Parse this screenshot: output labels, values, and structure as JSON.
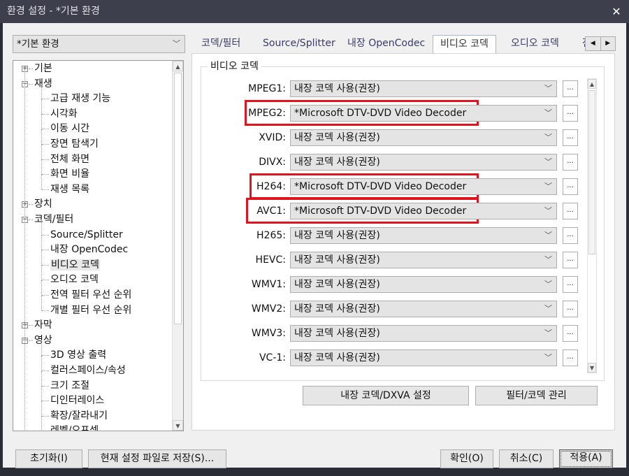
{
  "window": {
    "title": "환경 설정 - *기본 환경",
    "close": "✕"
  },
  "preset": {
    "value": "*기본 환경"
  },
  "tree": [
    {
      "label": "기본",
      "level": 0,
      "expander": "+"
    },
    {
      "label": "재생",
      "level": 0,
      "expander": "−"
    },
    {
      "label": "고급 재생 기능",
      "level": 1
    },
    {
      "label": "시각화",
      "level": 1
    },
    {
      "label": "이동 시간",
      "level": 1
    },
    {
      "label": "장면 탐색기",
      "level": 1
    },
    {
      "label": "전체 화면",
      "level": 1
    },
    {
      "label": "화면 비율",
      "level": 1
    },
    {
      "label": "재생 목록",
      "level": 1
    },
    {
      "label": "장치",
      "level": 0,
      "expander": "+"
    },
    {
      "label": "코덱/필터",
      "level": 0,
      "expander": "−"
    },
    {
      "label": "Source/Splitter",
      "level": 1
    },
    {
      "label": "내장 OpenCodec",
      "level": 1
    },
    {
      "label": "비디오 코덱",
      "level": 1,
      "selected": true
    },
    {
      "label": "오디오 코덱",
      "level": 1
    },
    {
      "label": "전역 필터 우선 순위",
      "level": 1
    },
    {
      "label": "개별 필터 우선 순위",
      "level": 1
    },
    {
      "label": "자막",
      "level": 0,
      "expander": "+"
    },
    {
      "label": "영상",
      "level": 0,
      "expander": "−"
    },
    {
      "label": "3D 영상 출력",
      "level": 1
    },
    {
      "label": "컬러스페이스/속성",
      "level": 1
    },
    {
      "label": "크기 조절",
      "level": 1
    },
    {
      "label": "디인터레이스",
      "level": 1
    },
    {
      "label": "확장/잘라내기",
      "level": 1
    },
    {
      "label": "레벨/오프셋",
      "level": 1
    }
  ],
  "tabs": [
    "코덱/필터",
    "Source/Splitter",
    "내장 OpenCodec",
    "비디오 코덱",
    "오디오 코덱",
    "전"
  ],
  "active_tab": "비디오 코덱",
  "group": {
    "title": "비디오 코덱"
  },
  "codecs": [
    {
      "label": "MPEG1:",
      "value": "내장 코덱 사용(권장)",
      "highlighted": false
    },
    {
      "label": "MPEG2:",
      "value": "*Microsoft DTV-DVD Video Decoder",
      "highlighted": true
    },
    {
      "label": "XVID:",
      "value": "내장 코덱 사용(권장)",
      "highlighted": false
    },
    {
      "label": "DIVX:",
      "value": "내장 코덱 사용(권장)",
      "highlighted": false
    },
    {
      "label": "H264:",
      "value": "*Microsoft DTV-DVD Video Decoder",
      "highlighted": true
    },
    {
      "label": "AVC1:",
      "value": "*Microsoft DTV-DVD Video Decoder",
      "highlighted": true
    },
    {
      "label": "H265:",
      "value": "내장 코덱 사용(권장)",
      "highlighted": false
    },
    {
      "label": "HEVC:",
      "value": "내장 코덱 사용(권장)",
      "highlighted": false
    },
    {
      "label": "WMV1:",
      "value": "내장 코덱 사용(권장)",
      "highlighted": false
    },
    {
      "label": "WMV2:",
      "value": "내장 코덱 사용(권장)",
      "highlighted": false
    },
    {
      "label": "WMV3:",
      "value": "내장 코덱 사용(권장)",
      "highlighted": false
    },
    {
      "label": "VC-1:",
      "value": "내장 코덱 사용(권장)",
      "highlighted": false
    }
  ],
  "more_label": "...",
  "panel_buttons": {
    "dxva": "내장 코덱/DXVA 설정",
    "filter": "필터/코덱 관리"
  },
  "footer": {
    "reset": "초기화(I)",
    "save": "현재 설정 파일로 저장(S)...",
    "ok": "확인(O)",
    "cancel": "취소(C)",
    "apply": "적용(A)"
  },
  "colors": {
    "highlight": "#e0141e",
    "titlebar": "#3d404c"
  }
}
